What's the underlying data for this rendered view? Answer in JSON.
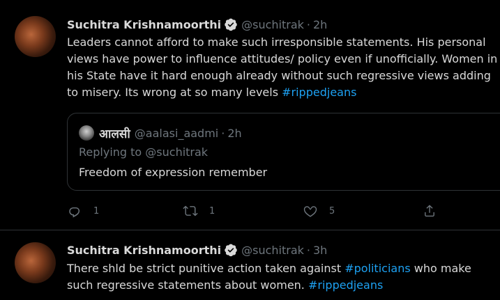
{
  "tweets": [
    {
      "display_name": "Suchitra Krishnamoorthi",
      "handle": "@suchitrak",
      "time": "2h",
      "text_plain": "Leaders cannot afford to make such irresponsible statements. His personal views have power to influence attitudes/ policy even if unofficially. Women in his State have it hard enough already without such regressive views adding to misery. Its wrong at so many levels ",
      "hashtag": "#rippedjeans",
      "quote": {
        "display_name": "आलसी",
        "handle": "@aalasi_aadmi",
        "time": "2h",
        "replying_to": "Replying to @suchitrak",
        "text": "Freedom of expression remember"
      },
      "actions": {
        "reply_count": "1",
        "retweet_count": "1",
        "like_count": "5"
      }
    },
    {
      "display_name": "Suchitra Krishnamoorthi",
      "handle": "@suchitrak",
      "time": "3h",
      "text_part1": "There shld be strict punitive action taken against ",
      "hashtag1": "#politicians",
      "text_part2": " who make such regressive statements about women. ",
      "hashtag2": "#rippedjeans"
    }
  ],
  "separator": "·",
  "colors": {
    "background": "#000000",
    "text": "#d9d9d9",
    "muted": "#6e767d",
    "link": "#1da1f2",
    "border": "#2f3336"
  },
  "icons": [
    "verified-badge-icon",
    "reply-icon",
    "retweet-icon",
    "like-icon",
    "share-icon"
  ]
}
